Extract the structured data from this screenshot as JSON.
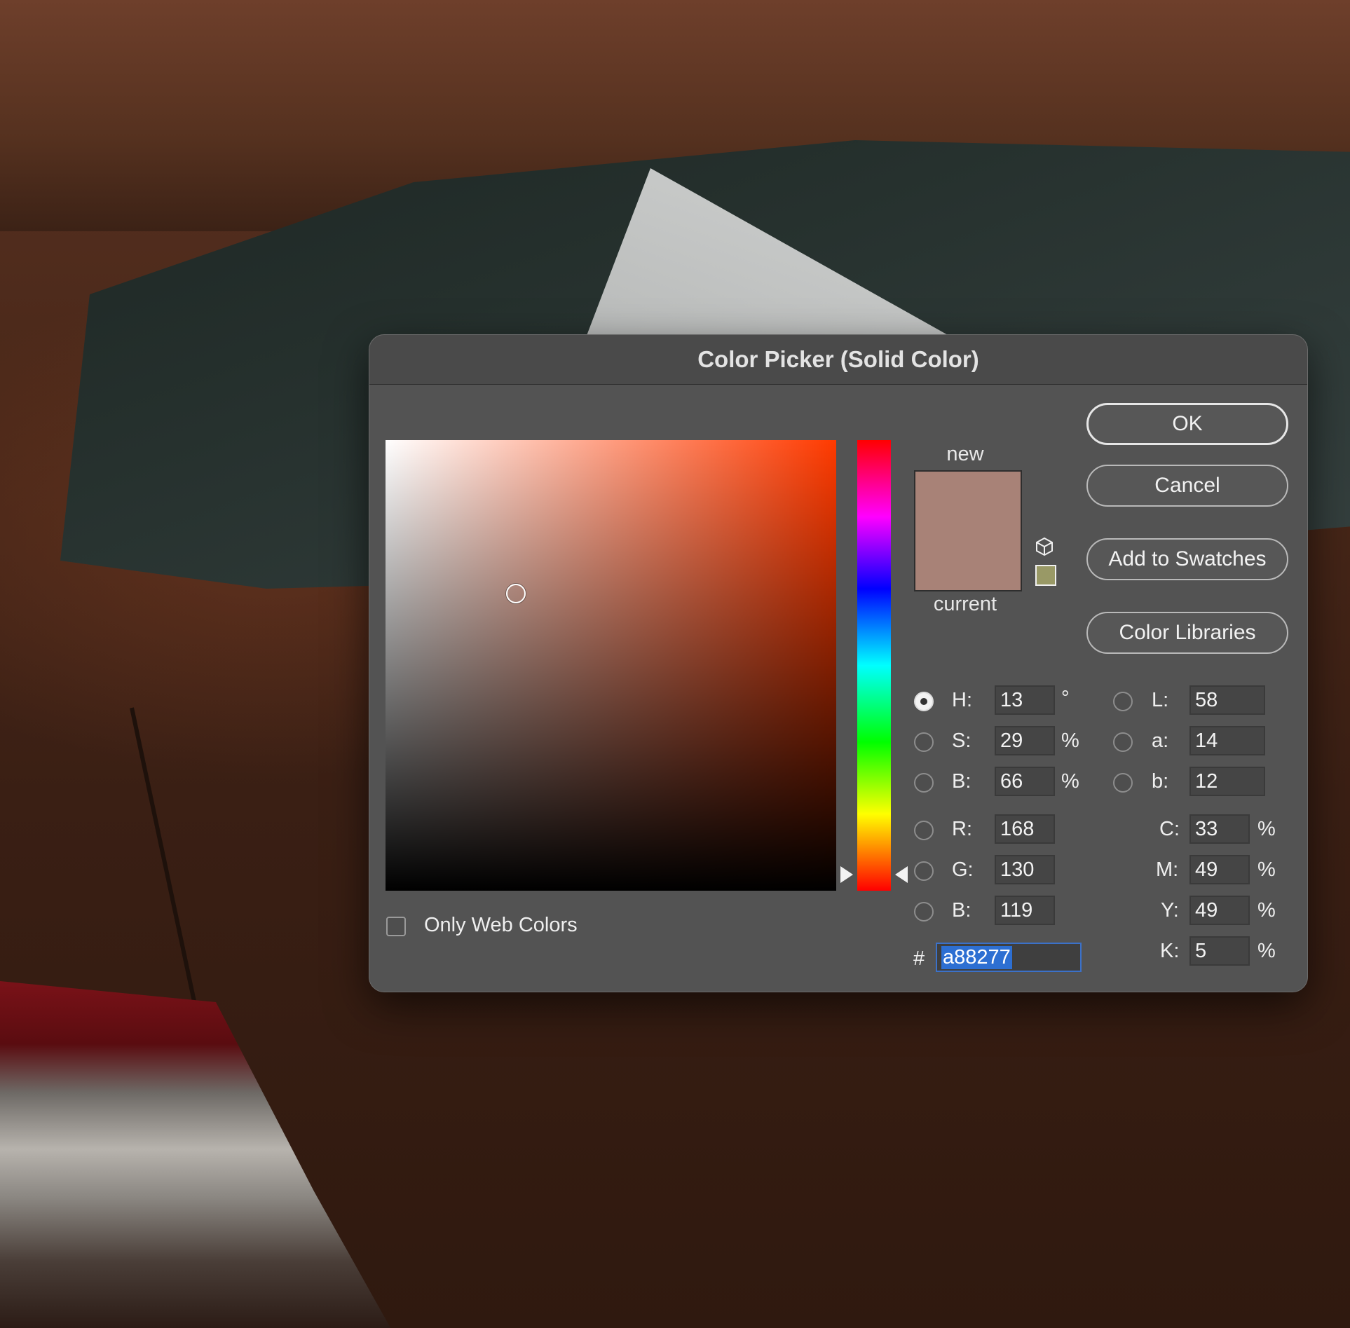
{
  "dialog": {
    "title": "Color Picker (Solid Color)",
    "buttons": {
      "ok": "OK",
      "cancel": "Cancel",
      "add_to_swatches": "Add to Swatches",
      "color_libraries": "Color Libraries"
    },
    "preview": {
      "new_label": "new",
      "current_label": "current",
      "new_color": "#a88277",
      "current_color": "#a88277",
      "web_safe_color": "#999966"
    },
    "hsb": {
      "h": {
        "label": "H:",
        "value": "13",
        "unit": "°"
      },
      "s": {
        "label": "S:",
        "value": "29",
        "unit": "%"
      },
      "b": {
        "label": "B:",
        "value": "66",
        "unit": "%"
      }
    },
    "rgb": {
      "r": {
        "label": "R:",
        "value": "168"
      },
      "g": {
        "label": "G:",
        "value": "130"
      },
      "b": {
        "label": "B:",
        "value": "119"
      }
    },
    "lab": {
      "l": {
        "label": "L:",
        "value": "58"
      },
      "a": {
        "label": "a:",
        "value": "14"
      },
      "b": {
        "label": "b:",
        "value": "12"
      }
    },
    "cmyk": {
      "c": {
        "label": "C:",
        "value": "33",
        "unit": "%"
      },
      "m": {
        "label": "M:",
        "value": "49",
        "unit": "%"
      },
      "y": {
        "label": "Y:",
        "value": "49",
        "unit": "%"
      },
      "k": {
        "label": "K:",
        "value": "5",
        "unit": "%"
      }
    },
    "hex": {
      "label": "#",
      "value": "a88277"
    },
    "only_web_colors": {
      "label": "Only Web Colors",
      "checked": false
    },
    "selected_mode": "H",
    "field_hue_color": "#ff3a00"
  }
}
